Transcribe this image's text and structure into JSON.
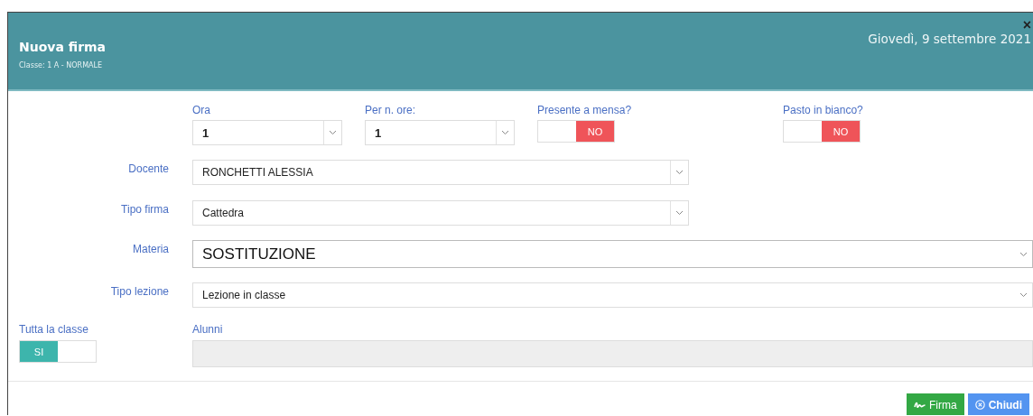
{
  "header": {
    "title": "Nuova firma",
    "subtitle": "Classe: 1 A - NORMALE",
    "date": "Giovedì, 9 settembre 2021",
    "close": "×"
  },
  "top_fields": [
    {
      "kind": "select",
      "label": "Ora",
      "value": "1"
    },
    {
      "kind": "select",
      "label": "Per n. ore:",
      "value": "1"
    },
    {
      "kind": "toggle",
      "label": "Presente a mensa?",
      "on": false,
      "text": "NO"
    },
    {
      "kind": "toggle",
      "label": "Pasto in bianco?",
      "on": false,
      "text": "NO"
    }
  ],
  "rows": [
    {
      "label": "Docente",
      "value": "RONCHETTI ALESSIA"
    },
    {
      "label": "Tipo firma",
      "value": "Cattedra"
    },
    {
      "label": "Materia",
      "value": "SOSTITUZIONE"
    },
    {
      "label": "Tipo lezione",
      "value": "Lezione in classe"
    }
  ],
  "class_toggle": {
    "label": "Tutta la classe",
    "on": true,
    "text": "SI"
  },
  "students": {
    "label": "Alunni",
    "disabled": true
  },
  "buttons": [
    {
      "kind": "sign",
      "label": "Firma"
    },
    {
      "kind": "close",
      "label": "Chiudi"
    }
  ]
}
